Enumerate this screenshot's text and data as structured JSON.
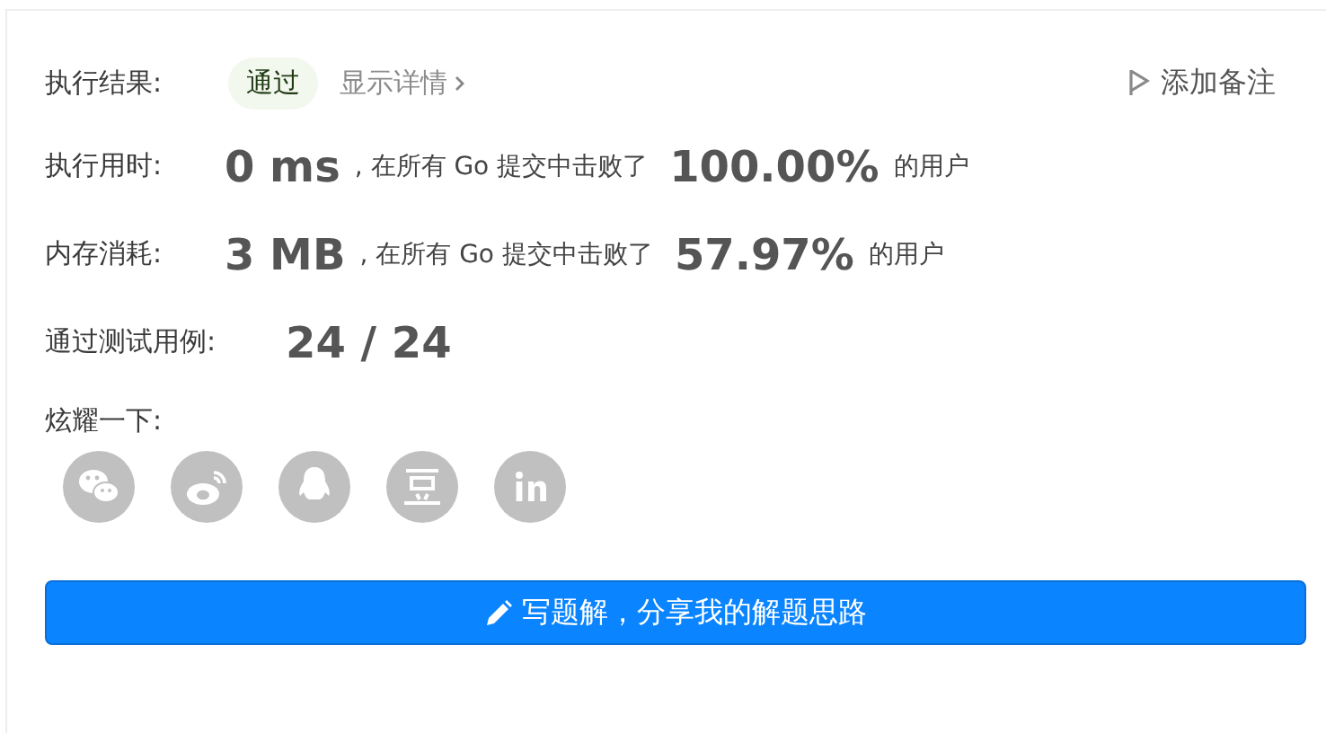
{
  "result": {
    "label": "执行结果:",
    "status": "通过",
    "details_link": "显示详情",
    "note_button": "添加备注"
  },
  "stats": [
    {
      "label": "执行用时:",
      "value": "0 ms",
      "text_before": ", 在所有 Go 提交中击败了",
      "percent": "100.00%",
      "text_after": "的用户"
    },
    {
      "label": "内存消耗:",
      "value": "3 MB",
      "text_before": ", 在所有 Go 提交中击败了",
      "percent": "57.97%",
      "text_after": "的用户"
    }
  ],
  "testcases": {
    "label": "通过测试用例:",
    "value": "24 / 24"
  },
  "share": {
    "label": "炫耀一下:",
    "targets": [
      {
        "kind": "wechat"
      },
      {
        "kind": "weibo"
      },
      {
        "kind": "qq"
      },
      {
        "kind": "douban"
      },
      {
        "kind": "linkedin"
      }
    ]
  },
  "write_button": {
    "label": "写题解，分享我的解题思路"
  }
}
